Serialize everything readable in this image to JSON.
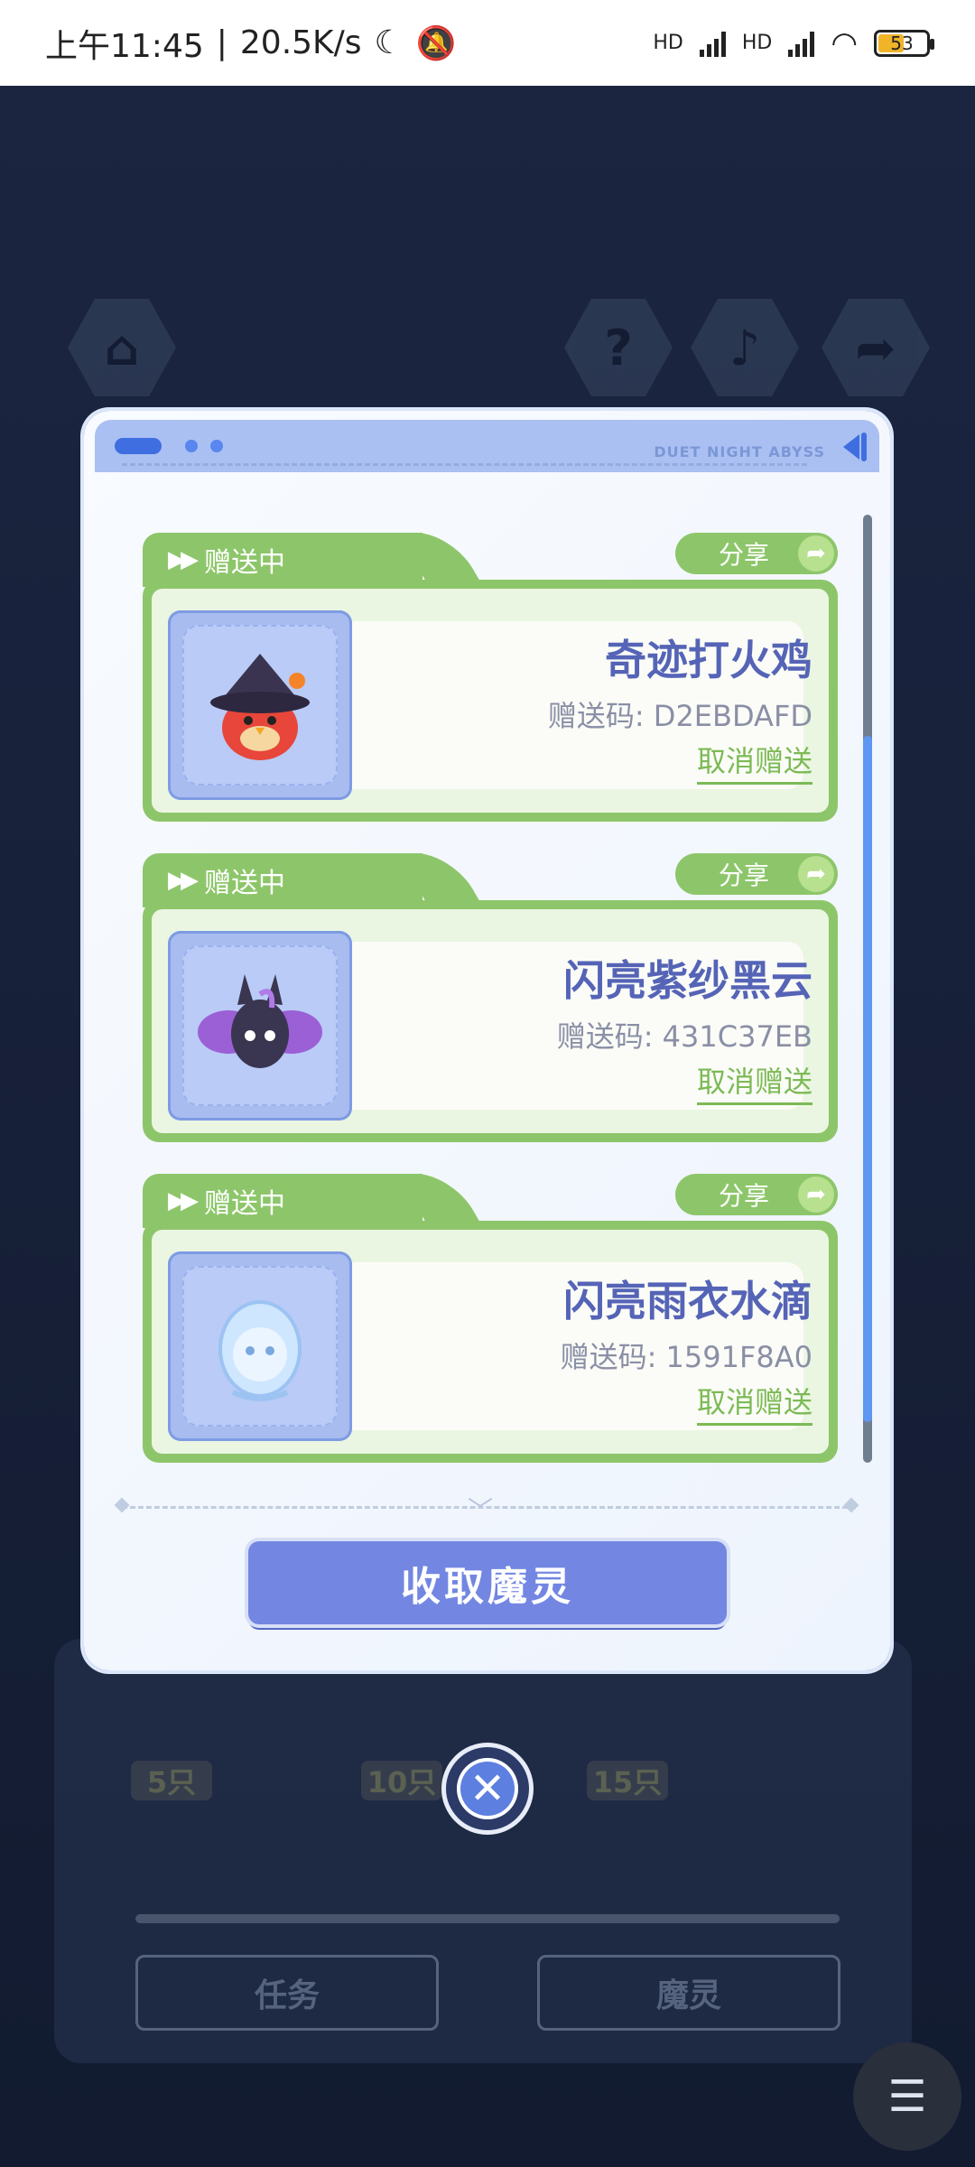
{
  "status_bar": {
    "time": "上午11:45",
    "speed": "20.5K/s",
    "battery": "53",
    "hd1": "HD",
    "hd2": "HD"
  },
  "background": {
    "tiers": [
      "5只",
      "10只",
      "15只"
    ],
    "tabs": [
      "任务",
      "魔灵"
    ]
  },
  "modal": {
    "header_text": "DUET NIGHT ABYSS",
    "gifts": [
      {
        "status": "赠送中",
        "share_label": "分享",
        "name": "奇迹打火鸡",
        "code": "赠送码: D2EBDAFD",
        "cancel_label": "取消赠送"
      },
      {
        "status": "赠送中",
        "share_label": "分享",
        "name": "闪亮紫纱黑云",
        "code": "赠送码: 431C37EB",
        "cancel_label": "取消赠送"
      },
      {
        "status": "赠送中",
        "share_label": "分享",
        "name": "闪亮雨衣水滴",
        "code": "赠送码: 1591F8A0",
        "cancel_label": "取消赠送"
      }
    ],
    "collect_label": "收取魔灵"
  },
  "colors": {
    "accent_green": "#8dc66a",
    "accent_blue": "#7286e2",
    "title_purple": "#5564b6"
  }
}
